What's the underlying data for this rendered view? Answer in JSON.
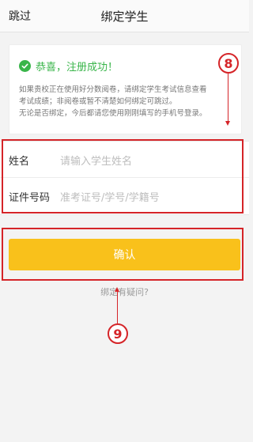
{
  "header": {
    "skip_label": "跳过",
    "title": "绑定学生"
  },
  "notice": {
    "success_title": "恭喜，注册成功！",
    "lines": [
      "如果贵校正在使用好分数阅卷，请绑定学生考试信息查看",
      "考试成绩；非阅卷或暂不清楚如何绑定可跳过。",
      "无论是否绑定，今后都请您使用刚刚填写的手机号登录。"
    ]
  },
  "form": {
    "name_label": "姓名",
    "name_placeholder": "请输入学生姓名",
    "id_label": "证件号码",
    "id_placeholder": "准考证号/学号/学籍号"
  },
  "confirm_label": "确认",
  "help_link": "绑定有疑问?",
  "annotations": {
    "marker_8": "8",
    "marker_9": "9",
    "color": "#d52428"
  },
  "colors": {
    "accent": "#f9c11b",
    "success": "#39b54a"
  }
}
